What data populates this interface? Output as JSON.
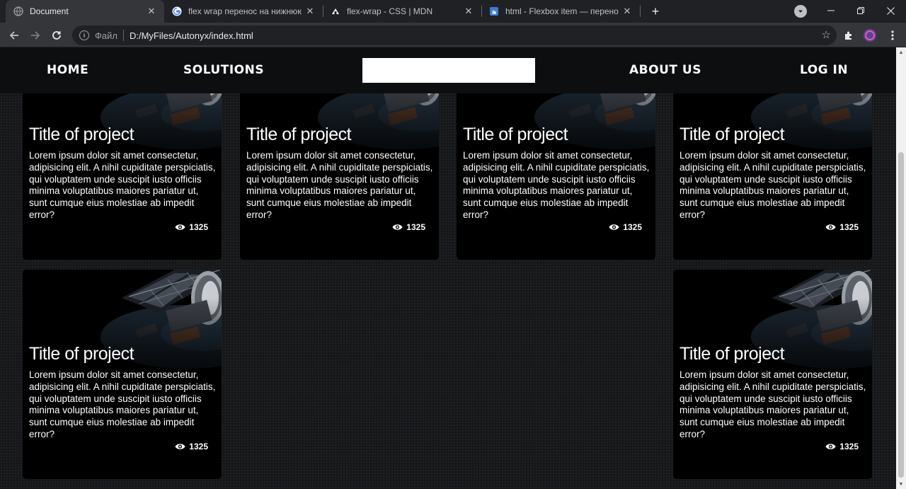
{
  "browser": {
    "tabs": [
      {
        "title": "Document",
        "favicon": "globe-icon",
        "active": true
      },
      {
        "title": "flex wrap перенос на нижнюю с",
        "favicon": "google-icon",
        "active": false
      },
      {
        "title": "flex-wrap - CSS | MDN",
        "favicon": "mdn-icon",
        "active": false
      },
      {
        "title": "html - Flexbox item — перенос",
        "favicon": "stackoverflow-icon",
        "active": false
      }
    ],
    "new_tab": "+",
    "address": {
      "scheme": "Файл",
      "url": "D:/MyFiles/Autonyx/index.html"
    },
    "window_controls": {
      "minimize": "—",
      "maximize": "❐",
      "close": "✕"
    }
  },
  "site": {
    "nav": {
      "home": "HOME",
      "solutions": "SOLUTIONS",
      "about": "ABOUT US",
      "login": "LOG IN"
    },
    "cards": [
      {
        "title": "Title of project",
        "description": "Lorem ipsum dolor sit amet consectetur, adipisicing elit. A nihil cupiditate perspiciatis, qui voluptatem unde suscipit iusto officiis minima voluptatibus maiores pariatur ut, sunt cumque eius molestiae ab impedit error?",
        "views": "1325"
      },
      {
        "title": "Title of project",
        "description": "Lorem ipsum dolor sit amet consectetur, adipisicing elit. A nihil cupiditate perspiciatis, qui voluptatem unde suscipit iusto officiis minima voluptatibus maiores pariatur ut, sunt cumque eius molestiae ab impedit error?",
        "views": "1325"
      },
      {
        "title": "Title of project",
        "description": "Lorem ipsum dolor sit amet consectetur, adipisicing elit. A nihil cupiditate perspiciatis, qui voluptatem unde suscipit iusto officiis minima voluptatibus maiores pariatur ut, sunt cumque eius molestiae ab impedit error?",
        "views": "1325"
      },
      {
        "title": "Title of project",
        "description": "Lorem ipsum dolor sit amet consectetur, adipisicing elit. A nihil cupiditate perspiciatis, qui voluptatem unde suscipit iusto officiis minima voluptatibus maiores pariatur ut, sunt cumque eius molestiae ab impedit error?",
        "views": "1325"
      },
      {
        "title": "Title of project",
        "description": "Lorem ipsum dolor sit amet consectetur, adipisicing elit. A nihil cupiditate perspiciatis, qui voluptatem unde suscipit iusto officiis minima voluptatibus maiores pariatur ut, sunt cumque eius molestiae ab impedit error?",
        "views": "1325"
      },
      {
        "title": "Title of project",
        "description": "Lorem ipsum dolor sit amet consectetur, adipisicing elit. A nihil cupiditate perspiciatis, qui voluptatem unde suscipit iusto officiis minima voluptatibus maiores pariatur ut, sunt cumque eius molestiae ab impedit error?",
        "views": "1325"
      }
    ]
  },
  "colors": {
    "page_bg": "#151719",
    "nav_bg": "#0d0e10",
    "card_bg": "#000000",
    "chrome_bg": "#202124",
    "toolbar_bg": "#35363a"
  }
}
